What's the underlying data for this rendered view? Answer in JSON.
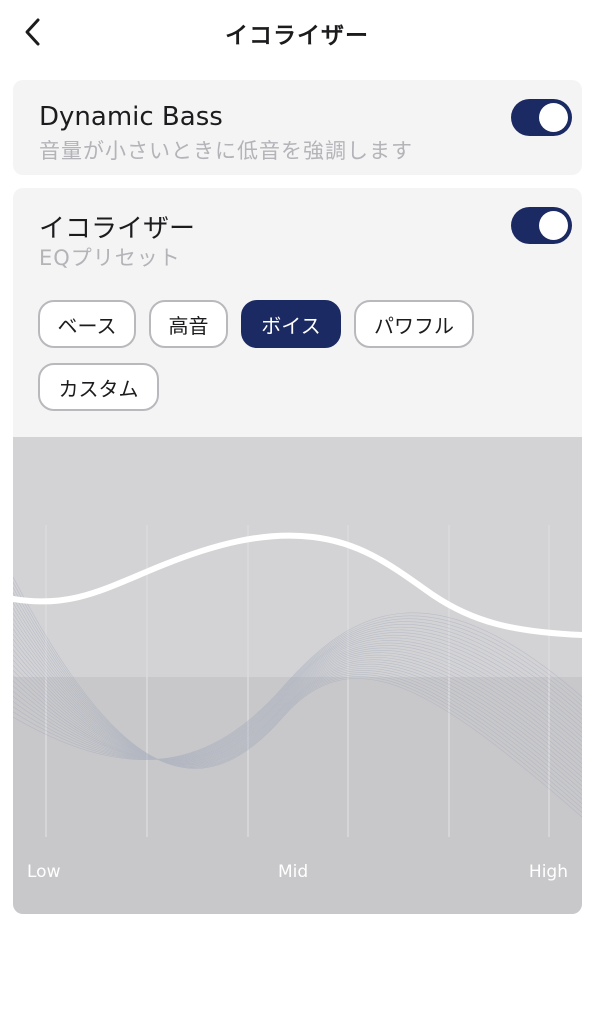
{
  "header": {
    "title": "イコライザー",
    "back_icon": "chevron-left-icon"
  },
  "dynamic_bass": {
    "title": "Dynamic Bass",
    "subtitle": "音量が小さいときに低音を強調します",
    "enabled": true
  },
  "equalizer": {
    "title": "イコライザー",
    "subtitle": "EQプリセット",
    "enabled": true,
    "presets": [
      {
        "label": "ベース",
        "selected": false
      },
      {
        "label": "高音",
        "selected": false
      },
      {
        "label": "ボイス",
        "selected": true
      },
      {
        "label": "パワフル",
        "selected": false
      },
      {
        "label": "カスタム",
        "selected": false
      }
    ],
    "graph": {
      "low_label": "Low",
      "mid_label": "Mid",
      "high_label": "High"
    }
  },
  "colors": {
    "accent": "#1b2a63",
    "card_bg": "#f4f4f5",
    "graph_bg": "#c8c8ca",
    "graph_bg_light": "#d3d3d5",
    "curve": "#ffffff"
  }
}
